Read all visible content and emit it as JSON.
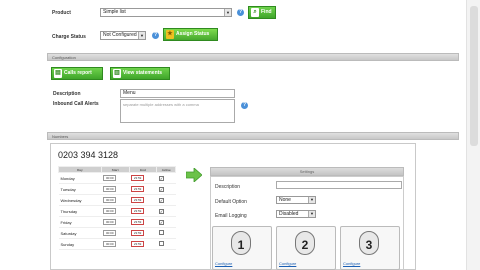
{
  "product": {
    "label": "Product",
    "value": "Simple list",
    "button": "Find"
  },
  "charge": {
    "label": "Charge Status",
    "value": "Not Configured",
    "button": "Assign Status"
  },
  "section1": {
    "title": "Configuration"
  },
  "actions": {
    "calls_report": "Calls report",
    "view_statements": "View statements"
  },
  "description": {
    "label": "Description",
    "value": "Menu"
  },
  "inbound": {
    "label": "Inbound Call Alerts",
    "placeholder": "separate multiple addresses with a comma"
  },
  "section2": {
    "title": "Numbers"
  },
  "phone_number": "0203 394 3128",
  "schedule": {
    "headers": [
      "Day",
      "Start",
      "End",
      "Active"
    ],
    "rows": [
      {
        "day": "Monday",
        "start": "00:00",
        "end": "23:59",
        "active": true
      },
      {
        "day": "Tuesday",
        "start": "00:00",
        "end": "23:59",
        "active": true
      },
      {
        "day": "Wednesday",
        "start": "00:00",
        "end": "23:59",
        "active": true
      },
      {
        "day": "Thursday",
        "start": "00:00",
        "end": "23:59",
        "active": true
      },
      {
        "day": "Friday",
        "start": "00:00",
        "end": "23:59",
        "active": true
      },
      {
        "day": "Saturday",
        "start": "00:00",
        "end": "23:59",
        "active": false
      },
      {
        "day": "Sunday",
        "start": "00:00",
        "end": "23:59",
        "active": false
      }
    ]
  },
  "settings": {
    "header": "Settings",
    "description_label": "Description",
    "default_option_label": "Default Option",
    "default_option_value": "None",
    "email_logging_label": "Email Logging",
    "email_logging_value": "Disabled"
  },
  "options": [
    {
      "number": "1",
      "link": "Configure"
    },
    {
      "number": "2",
      "link": "Configure"
    },
    {
      "number": "3",
      "link": "Configure"
    }
  ]
}
